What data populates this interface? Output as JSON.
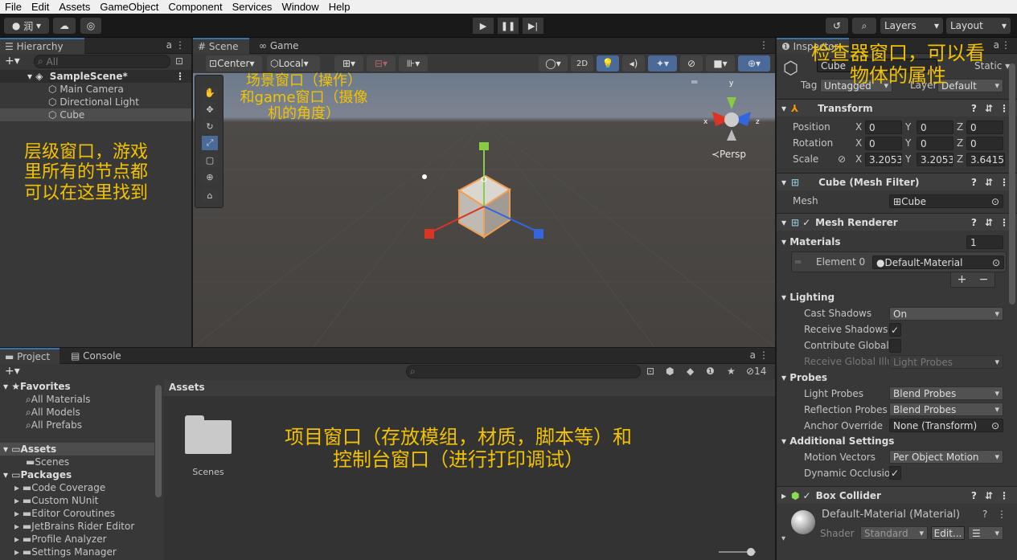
{
  "menu": [
    "File",
    "Edit",
    "Assets",
    "GameObject",
    "Component",
    "Services",
    "Window",
    "Help"
  ],
  "toolbar": {
    "account": "润",
    "layers": "Layers",
    "layout": "Layout"
  },
  "hierarchy": {
    "tab": "Hierarchy",
    "search_placeholder": "All",
    "scene": "SampleScene*",
    "items": [
      "Main Camera",
      "Directional Light",
      "Cube"
    ]
  },
  "scene_view": {
    "tab_scene": "Scene",
    "tab_game": "Game",
    "pivot": "Center",
    "space": "Local",
    "mode2d": "2D",
    "persp": "≺Persp",
    "gizmo_x": "x",
    "gizmo_y": "y",
    "gizmo_z": "z"
  },
  "project": {
    "tab_project": "Project",
    "tab_console": "Console",
    "hidden_count": "14",
    "favorites": "Favorites",
    "fav_items": [
      "All Materials",
      "All Models",
      "All Prefabs"
    ],
    "assets": "Assets",
    "assets_items": [
      "Scenes"
    ],
    "packages": "Packages",
    "package_items": [
      "Code Coverage",
      "Custom NUnit",
      "Editor Coroutines",
      "JetBrains Rider Editor",
      "Profile Analyzer",
      "Settings Manager"
    ],
    "breadcrumb": "Assets",
    "folder_label": "Scenes"
  },
  "inspector": {
    "tab": "Inspector",
    "object_name": "Cube",
    "static": "Static",
    "tag_label": "Tag",
    "tag_value": "Untagged",
    "layer_label": "Layer",
    "layer_value": "Default",
    "transform": {
      "title": "Transform",
      "position": "Position",
      "rotation": "Rotation",
      "scale": "Scale",
      "pos": [
        "0",
        "0",
        "0"
      ],
      "rot": [
        "0",
        "0",
        "0"
      ],
      "scl": [
        "3.2053",
        "3.2053",
        "3.6415"
      ]
    },
    "mesh_filter": {
      "title": "Cube (Mesh Filter)",
      "mesh_label": "Mesh",
      "mesh_value": "Cube"
    },
    "mesh_renderer": {
      "title": "Mesh Renderer",
      "materials": "Materials",
      "materials_count": "1",
      "element": "Element 0",
      "element_value": "Default-Material",
      "lighting": "Lighting",
      "cast_shadows": "Cast Shadows",
      "cast_shadows_value": "On",
      "receive_shadows": "Receive Shadows",
      "contribute_gi": "Contribute Global I",
      "receive_gi": "Receive Global Illu",
      "receive_gi_value": "Light Probes",
      "probes": "Probes",
      "light_probes": "Light Probes",
      "light_probes_value": "Blend Probes",
      "reflection_probes": "Reflection Probes",
      "reflection_probes_value": "Blend Probes",
      "anchor_override": "Anchor Override",
      "anchor_override_value": "None (Transform)",
      "additional": "Additional Settings",
      "motion_vectors": "Motion Vectors",
      "motion_vectors_value": "Per Object Motion",
      "dynamic_occlusion": "Dynamic Occlusio"
    },
    "box_collider": {
      "title": "Box Collider"
    },
    "material": {
      "name": "Default-Material (Material)",
      "shader_label": "Shader",
      "shader_value": "Standard",
      "edit": "Edit..."
    }
  },
  "annotations": {
    "hierarchy": "层级窗口，游戏里所有的节点都可以在这里找到",
    "scene": "场景窗口（操作）和game窗口（摄像机的角度）",
    "inspector": "检查器窗口，可以看物体的属性",
    "project": "项目窗口（存放模组，材质，脚本等）和控制台窗口（进行打印调试）"
  },
  "colors": {
    "annotation": "#f2c200",
    "accent": "#3a72b0"
  }
}
